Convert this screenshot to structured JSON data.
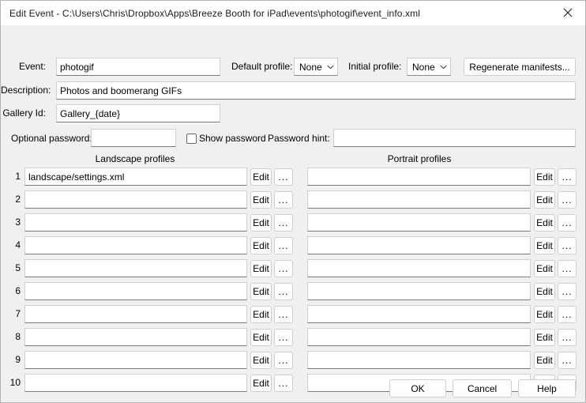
{
  "window": {
    "title": "Edit Event - C:\\Users\\Chris\\Dropbox\\Apps\\Breeze Booth for iPad\\events\\photogif\\event_info.xml",
    "close_label": "close-icon"
  },
  "form": {
    "event_label": "Event:",
    "event_value": "photogif",
    "default_profile_label": "Default profile:",
    "default_profile_value": "None",
    "initial_profile_label": "Initial profile:",
    "initial_profile_value": "None",
    "regenerate_button": "Regenerate manifests...",
    "description_label": "Description:",
    "description_value": "Photos and boomerang GIFs",
    "gallery_id_label": "Gallery Id:",
    "gallery_id_value": "Gallery_{date}",
    "optional_password_label": "Optional password:",
    "optional_password_value": "",
    "show_password_label": "Show password",
    "show_password_checked": false,
    "password_hint_label": "Password hint:",
    "password_hint_value": ""
  },
  "profiles": {
    "landscape_header": "Landscape profiles",
    "portrait_header": "Portrait profiles",
    "edit_label": "Edit",
    "browse_label": "...",
    "rows": [
      {
        "num": "1",
        "landscape": "landscape/settings.xml",
        "portrait": ""
      },
      {
        "num": "2",
        "landscape": "",
        "portrait": ""
      },
      {
        "num": "3",
        "landscape": "",
        "portrait": ""
      },
      {
        "num": "4",
        "landscape": "",
        "portrait": ""
      },
      {
        "num": "5",
        "landscape": "",
        "portrait": ""
      },
      {
        "num": "6",
        "landscape": "",
        "portrait": ""
      },
      {
        "num": "7",
        "landscape": "",
        "portrait": ""
      },
      {
        "num": "8",
        "landscape": "",
        "portrait": ""
      },
      {
        "num": "9",
        "landscape": "",
        "portrait": ""
      },
      {
        "num": "10",
        "landscape": "",
        "portrait": ""
      }
    ]
  },
  "footer": {
    "ok_label": "OK",
    "cancel_label": "Cancel",
    "help_label": "Help"
  },
  "colors": {
    "dialog_bg": "#f0f0f0",
    "field_bg": "#ffffff",
    "border": "#cfcfcf",
    "text": "#000000"
  }
}
